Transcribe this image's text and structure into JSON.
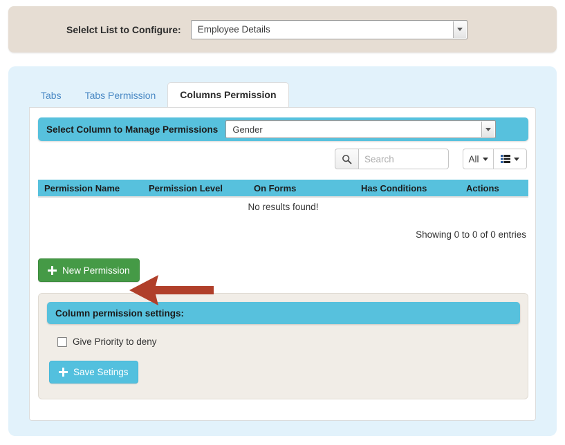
{
  "top_panel": {
    "label": "Selelct List to Configure:",
    "select": {
      "value": "Employee Details",
      "icon": "chevron-down-icon"
    }
  },
  "tabs": [
    {
      "label": "Tabs",
      "active": false
    },
    {
      "label": "Tabs Permission",
      "active": false
    },
    {
      "label": "Columns Permission",
      "active": true
    }
  ],
  "column_selector": {
    "label": "Select Column to Manage Permissions",
    "select": {
      "value": "Gender",
      "icon": "chevron-down-icon"
    }
  },
  "toolbar": {
    "search_icon": "search-icon",
    "search_placeholder": "Search",
    "search_value": "",
    "filter_all_label": "All",
    "columns_icon": "list-columns-icon",
    "caret_icon": "caret-down-icon"
  },
  "table": {
    "columns": [
      "Permission Name",
      "Permission Level",
      "On Forms",
      "Has Conditions",
      "Actions"
    ],
    "rows": [],
    "empty_message": "No results found!",
    "info": "Showing 0 to 0 of 0 entries"
  },
  "actions": {
    "new_permission_label": "New Permission",
    "new_permission_icon": "plus-icon"
  },
  "annotation": {
    "type": "arrow-left",
    "color": "#b03f2a",
    "points_to": "new-permission-button"
  },
  "settings": {
    "heading": "Column permission settings:",
    "checkbox_label": "Give Priority to deny",
    "checkbox_checked": false,
    "save_label": "Save Setings",
    "save_icon": "plus-icon"
  },
  "colors": {
    "teal": "#57c1dd",
    "panel_blue": "#e2f2fb",
    "panel_beige": "#e6ddd3",
    "settings_beige": "#f1ede7",
    "green": "#459a46",
    "tab_link": "#4a89c4",
    "arrow_red": "#b03f2a"
  }
}
